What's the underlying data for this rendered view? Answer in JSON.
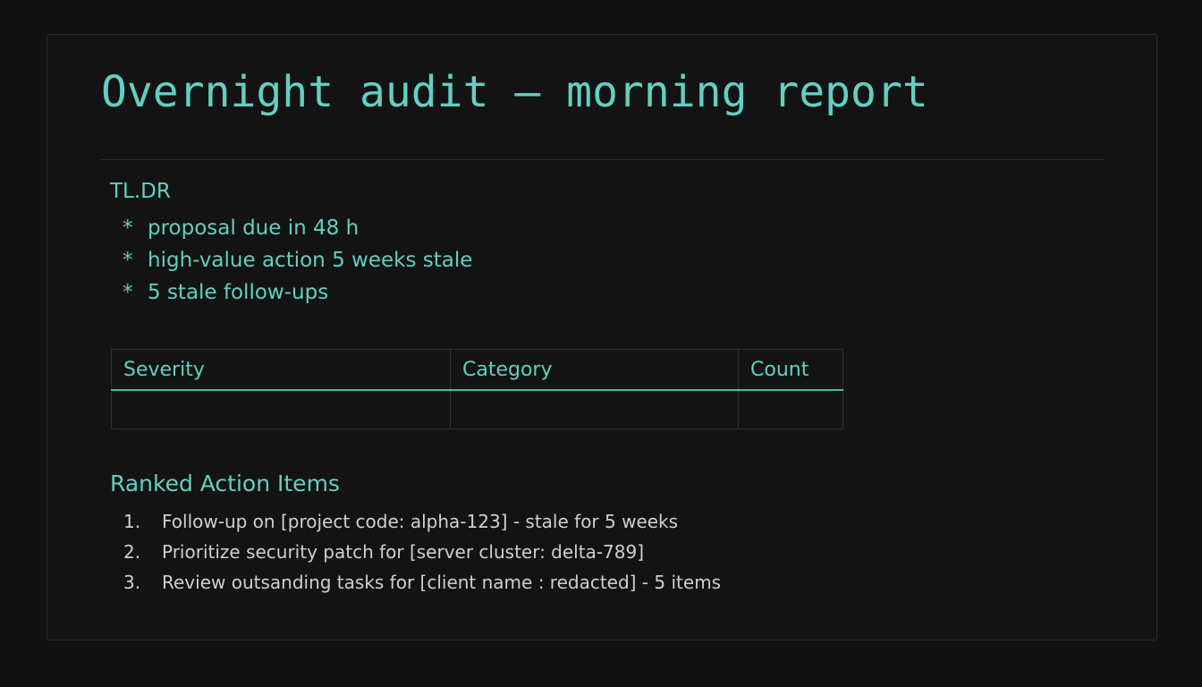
{
  "report": {
    "title": "Overnight audit — morning report"
  },
  "tldr": {
    "heading": "TL.DR",
    "bullet": "*",
    "items": [
      "proposal due in 48 h",
      "high-value action 5 weeks stale",
      "5 stale follow-ups"
    ]
  },
  "summary_table": {
    "columns": [
      "Severity",
      "Category",
      "Count"
    ],
    "rows": [
      [
        "",
        "",
        ""
      ]
    ]
  },
  "ranked": {
    "heading": "Ranked Action Items",
    "items": [
      {
        "number": "1.",
        "text": "Follow-up on [project code: alpha-123] - stale for 5 weeks"
      },
      {
        "number": "2.",
        "text": "Prioritize security patch for [server cluster: delta-789]"
      },
      {
        "number": "3.",
        "text": "Review outsanding tasks for [client name : redacted] - 5 items"
      }
    ]
  },
  "colors": {
    "background": "#121212",
    "accent": "#63cfc2",
    "body_text": "#cfcfcf",
    "border": "#2f2f2f"
  }
}
